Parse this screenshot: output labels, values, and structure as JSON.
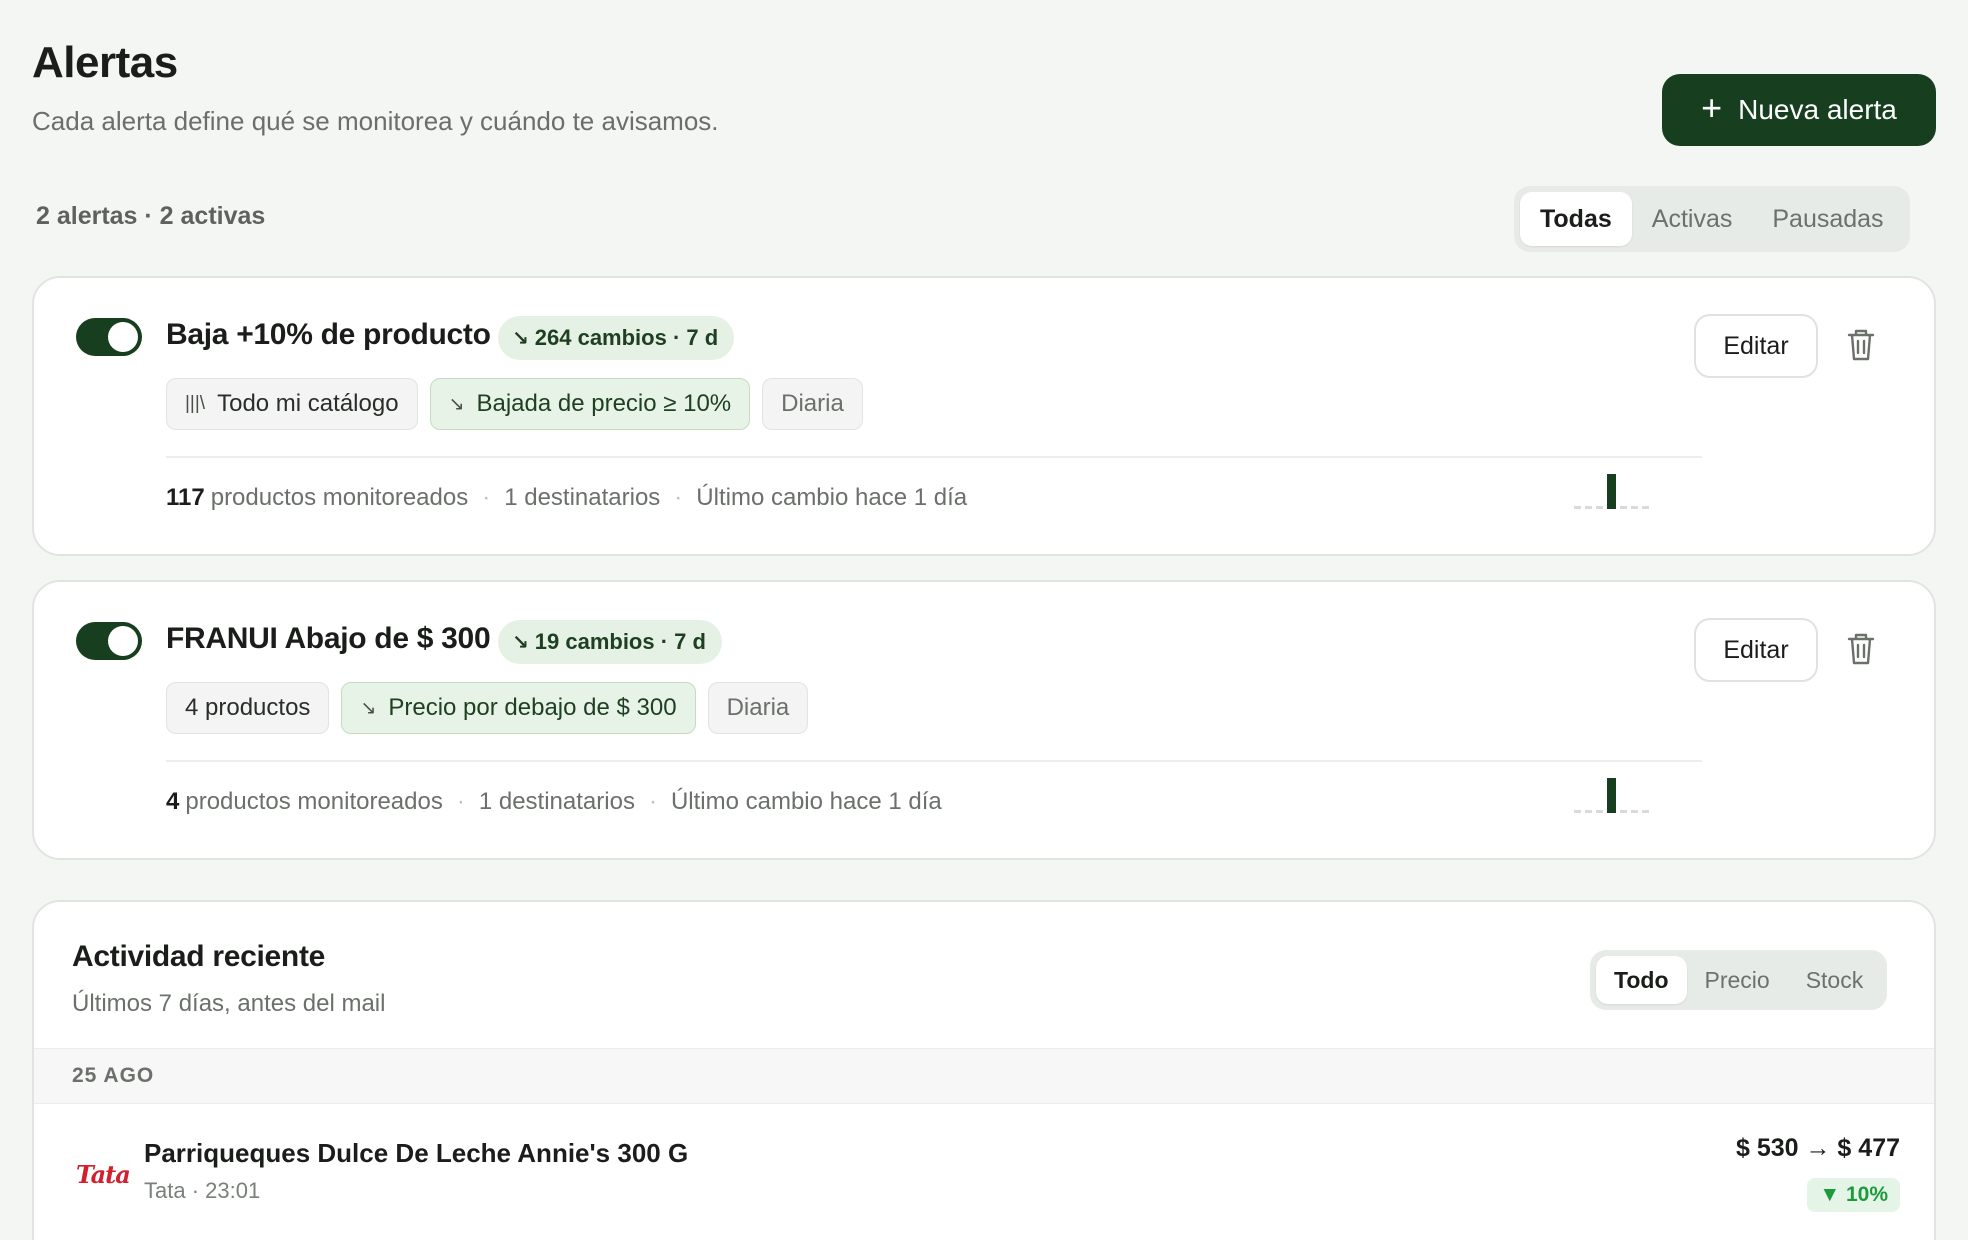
{
  "header": {
    "title": "Alertas",
    "subtitle": "Cada alerta define qué se monitorea y cuándo te avisamos.",
    "new_alert_label": "Nueva alerta"
  },
  "summary": "2 alertas · 2 activas",
  "filters": {
    "all": "Todas",
    "active": "Activas",
    "paused": "Pausadas",
    "selected": "Todas"
  },
  "alerts": [
    {
      "enabled": true,
      "title": "Baja +10% de producto",
      "badge": "264 cambios · 7 d",
      "chips": {
        "scope": "Todo mi catálogo",
        "condition": "Bajada de precio ≥ 10%",
        "frequency": "Diaria"
      },
      "meta": {
        "count": "117",
        "count_label": "productos monitoreados",
        "recipients": "1 destinatarios",
        "last_change": "Último cambio hace 1 día"
      },
      "edit_label": "Editar"
    },
    {
      "enabled": true,
      "title": "FRANUI Abajo de $ 300",
      "badge": "19 cambios · 7 d",
      "chips": {
        "scope": "4 productos",
        "condition": "Precio por debajo de $ 300",
        "frequency": "Diaria"
      },
      "meta": {
        "count": "4",
        "count_label": "productos monitoreados",
        "recipients": "1 destinatarios",
        "last_change": "Último cambio hace 1 día"
      },
      "edit_label": "Editar"
    }
  ],
  "activity": {
    "title": "Actividad reciente",
    "subtitle": "Últimos 7 días, antes del mail",
    "filters": {
      "all": "Todo",
      "price": "Precio",
      "stock": "Stock",
      "selected": "Todo"
    },
    "date_group": "25 AGO",
    "items": [
      {
        "store_logo": "Tata",
        "product": "Parriqueques Dulce De Leche Annie's 300 G",
        "meta": "Tata · 23:01",
        "price_change": "$ 530 → $ 477",
        "drop": "▼ 10%"
      }
    ]
  },
  "colors": {
    "accent": "#173f1f",
    "badge_bg": "#e6f1e6",
    "drop_green": "#1d9a3d",
    "tata_red": "#d0202d"
  }
}
